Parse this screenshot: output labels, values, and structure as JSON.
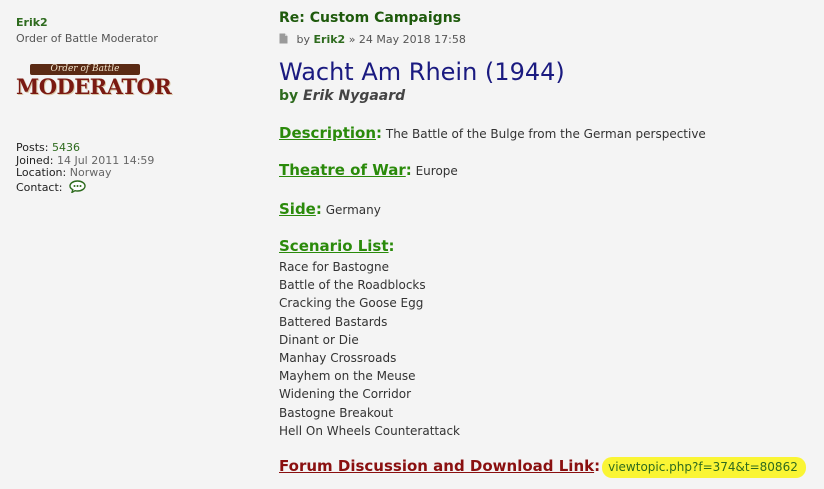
{
  "profile": {
    "username": "Erik2",
    "rank_title": "Order of Battle Moderator",
    "rank_image": {
      "top_text": "Order of Battle",
      "main_text": "MODERATOR"
    },
    "posts_label": "Posts:",
    "posts_value": "5436",
    "joined_label": "Joined:",
    "joined_value": "14 Jul 2011 14:59",
    "location_label": "Location:",
    "location_value": "Norway",
    "contact_label": "Contact:",
    "contact_icon": "speech-bubble-icon"
  },
  "post": {
    "title": "Re: Custom Campaigns",
    "meta_prefix": "by",
    "author": "Erik2",
    "meta_sep": "»",
    "timestamp": "24 May 2018 17:58",
    "post_icon": "document-icon",
    "campaign_title": "Wacht Am Rhein (1944)",
    "byline_prefix": "by",
    "byline_name": "Erik Nygaard",
    "description_label": "Description",
    "description_value": "The Battle of the Bulge from the German perspective",
    "theatre_label": "Theatre of War",
    "theatre_value": "Europe",
    "side_label": "Side",
    "side_value": "Germany",
    "scenario_label": "Scenario List",
    "scenarios": [
      "Race for Bastogne",
      "Battle of the Roadblocks",
      "Cracking the Goose Egg",
      "Battered Bastards",
      "Dinant or Die",
      "Manhay Crossroads",
      "Mayhem on the Meuse",
      "Widening the Corridor",
      "Bastogne Breakout",
      "Hell On Wheels Counterattack"
    ],
    "forum_label": "Forum Discussion and Download Link",
    "forum_link": "viewtopic.php?f=374&t=80862"
  },
  "colors": {
    "background": "#f4f4f4",
    "username_green": "#2e6b1e",
    "section_green": "#2a8a0a",
    "campaign_navy": "#1a1a80",
    "forum_red": "#8a1010",
    "highlight_yellow": "#faf534"
  }
}
